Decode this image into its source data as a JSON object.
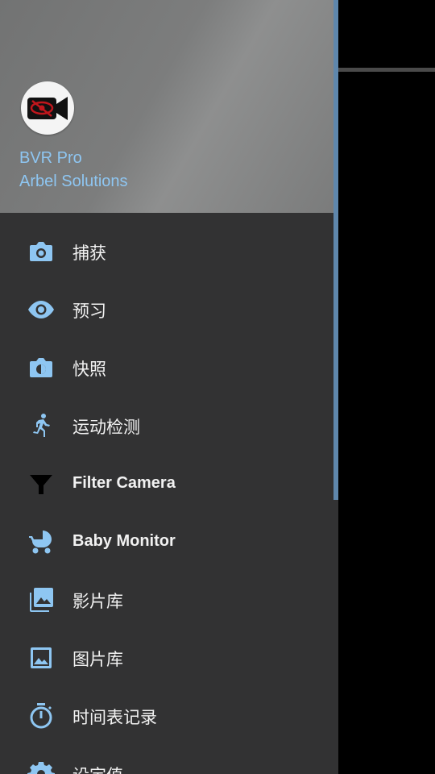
{
  "header": {
    "app_name": "BVR Pro",
    "company": "Arbel Solutions",
    "logo_icon": "video-camera-hidden-eye-icon"
  },
  "menu": {
    "items": [
      {
        "label": "捕获",
        "icon": "camera-icon"
      },
      {
        "label": "预习",
        "icon": "eye-icon"
      },
      {
        "label": "快照",
        "icon": "camera-switch-icon"
      },
      {
        "label": "运动检测",
        "icon": "running-person-icon"
      },
      {
        "label": "Filter Camera",
        "icon": "filter-icon"
      },
      {
        "label": "Baby Monitor",
        "icon": "stroller-icon"
      },
      {
        "label": "影片库",
        "icon": "photo-library-icon"
      },
      {
        "label": "图片库",
        "icon": "image-icon"
      },
      {
        "label": "时间表记录",
        "icon": "timer-icon"
      },
      {
        "label": "设定值",
        "icon": "settings-gear-icon"
      }
    ]
  },
  "colors": {
    "accent": "#8ec6f2",
    "icon_blue": "#8ec6f2",
    "drawer_bg": "#323233",
    "header_bg": "#7c7d7d"
  }
}
